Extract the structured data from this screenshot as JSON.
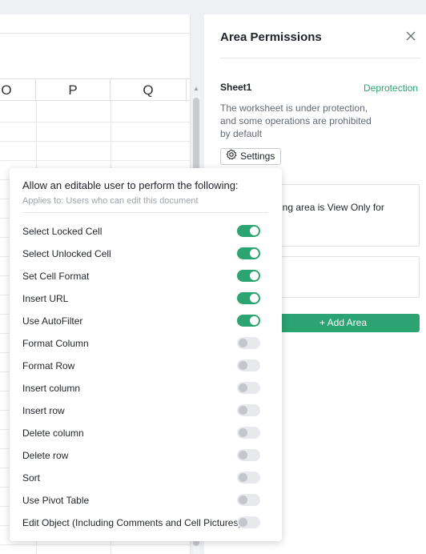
{
  "sheet": {
    "columns": [
      "O",
      "P",
      "Q"
    ]
  },
  "panel": {
    "title": "Area Permissions",
    "sheet_name": "Sheet1",
    "deprotect_label": "Deprotection",
    "description": "The worksheet is under protection, and some operations are prohibited by default",
    "settings_label": "Settings",
    "area_card_text": "ing area is View Only for",
    "add_area_label": "+  Add Area"
  },
  "popup": {
    "title": "Allow an editable user to perform the following:",
    "subtitle": "Applies to: Users who can edit this document",
    "permissions": [
      {
        "label": "Select Locked Cell",
        "enabled": true
      },
      {
        "label": "Select Unlocked Cell",
        "enabled": true
      },
      {
        "label": "Set Cell Format",
        "enabled": true
      },
      {
        "label": "Insert URL",
        "enabled": true
      },
      {
        "label": "Use AutoFilter",
        "enabled": true
      },
      {
        "label": "Format Column",
        "enabled": false
      },
      {
        "label": "Format Row",
        "enabled": false
      },
      {
        "label": "Insert column",
        "enabled": false
      },
      {
        "label": "Insert row",
        "enabled": false
      },
      {
        "label": "Delete column",
        "enabled": false
      },
      {
        "label": "Delete row",
        "enabled": false
      },
      {
        "label": "Sort",
        "enabled": false
      },
      {
        "label": "Use Pivot Table",
        "enabled": false
      },
      {
        "label": "Edit Object (Including Comments and Cell Pictures)",
        "enabled": false
      }
    ]
  },
  "colors": {
    "accent": "#2ba471",
    "toggle_off": "#e8e9ed"
  }
}
